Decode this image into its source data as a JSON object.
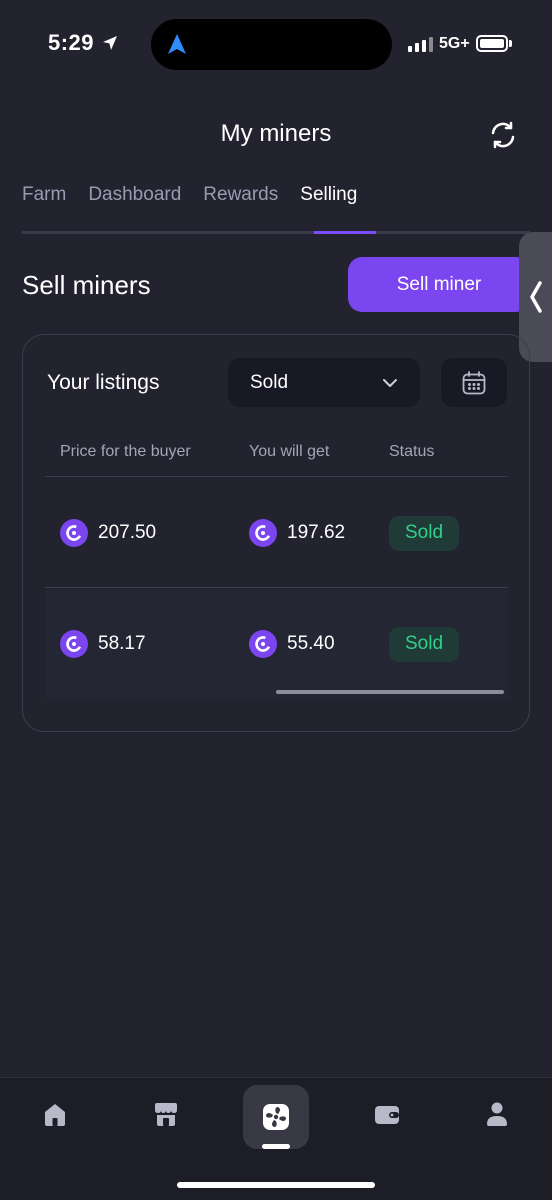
{
  "status_bar": {
    "time": "5:29",
    "network": "5G+"
  },
  "header": {
    "title": "My miners"
  },
  "tabs": [
    {
      "label": "Farm",
      "active": false
    },
    {
      "label": "Dashboard",
      "active": false
    },
    {
      "label": "Rewards",
      "active": false
    },
    {
      "label": "Selling",
      "active": true
    }
  ],
  "section": {
    "title": "Sell miners",
    "sell_button_label": "Sell miner"
  },
  "listings": {
    "title": "Your listings",
    "filter_value": "Sold",
    "columns": [
      "Price for the buyer",
      "You will get",
      "Status"
    ],
    "rows": [
      {
        "price": "207.50",
        "you_get": "197.62",
        "status": "Sold"
      },
      {
        "price": "58.17",
        "you_get": "55.40",
        "status": "Sold"
      }
    ]
  },
  "bottom_nav": {
    "items": [
      "home-icon",
      "market-icon",
      "miners-icon",
      "wallet-icon",
      "profile-icon"
    ],
    "active": "miners-icon"
  },
  "colors": {
    "accent": "#7b45ef",
    "background": "#22232f",
    "status_green": "#2fd08a"
  }
}
